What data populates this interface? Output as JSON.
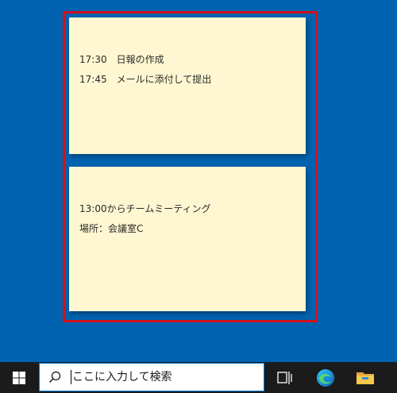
{
  "notes": [
    {
      "lines": [
        "17:30　日報の作成",
        "17:45　メールに添付して提出"
      ],
      "color": "#fff7d1"
    },
    {
      "lines": [
        "13:00からチームミーティング",
        "場所：会議室C"
      ],
      "color": "#fff7d1"
    }
  ],
  "highlight": {
    "color": "#d0121b"
  },
  "taskbar": {
    "search_placeholder": "ここに入力して検索",
    "icons": [
      "windows-start-icon",
      "search-icon",
      "task-view-icon",
      "edge-icon",
      "file-explorer-icon"
    ]
  },
  "colors": {
    "desktop": "#0063b1",
    "taskbar": "#1b1b1b",
    "accent": "#0078d7"
  }
}
